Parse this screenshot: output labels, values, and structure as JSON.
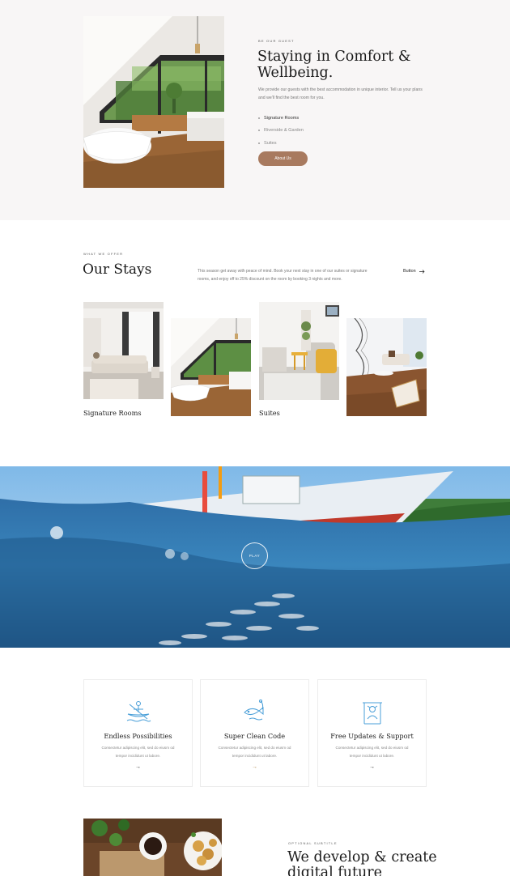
{
  "welcome": {
    "eyebrow": "BE OUR GUEST",
    "title_line1": "Staying in Comfort &",
    "title_line2": "Wellbeing.",
    "description": "We provide our guests with the best accommodation in unique interior. Tell us your plans and we'll find the best room for you.",
    "features": [
      "Signature Rooms",
      "Riverside & Garden",
      "Suites"
    ],
    "cta_label": "About Us",
    "accent_color": "#a87a5f"
  },
  "stays": {
    "eyebrow": "WHAT WE OFFER",
    "title": "Our Stays",
    "description": "This season get away with peace of mind. Book your next stay in one of our suites or signature rooms, and enjoy off to 25% discount on the room by booking 3 nights and more.",
    "button_label": "Button",
    "button_icon": "arrow-right-icon",
    "cards": [
      {
        "caption": "Signature Rooms"
      },
      {
        "caption": ""
      },
      {
        "caption": "Suites"
      },
      {
        "caption": ""
      }
    ]
  },
  "video": {
    "play_label": "PLAY"
  },
  "features": [
    {
      "icon": "kayak-icon",
      "title": "Endless Possibilities",
      "description": "Consectetur adipiscing elit, sed do eiusm od tempor incididunt ut labore.",
      "arrow": "→",
      "arrow_color": "#222222"
    },
    {
      "icon": "fishing-icon",
      "title": "Super Clean Code",
      "description": "Consectetur adipiscing elit, sed do eiusm od tempor incididunt ut labore.",
      "arrow": "→",
      "arrow_color": "#b08a4a"
    },
    {
      "icon": "gazebo-icon",
      "title": "Free Updates & Support",
      "description": "Consectetur adipiscing elit, sed do eiusm od tempor incididunt ut labore.",
      "arrow": "→",
      "arrow_color": "#222222"
    }
  ],
  "develop": {
    "eyebrow": "OPTIONAL SUBTITLE",
    "title_line1": "We develop & create",
    "title_line2": "digital future"
  },
  "icon_color": "#4a9fd8"
}
